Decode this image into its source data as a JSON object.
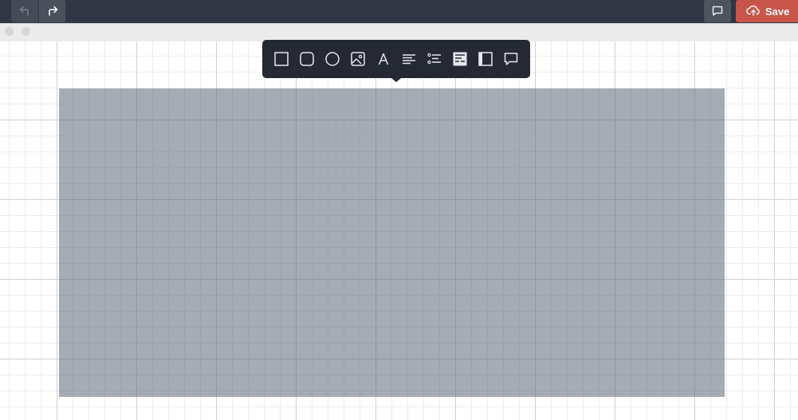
{
  "header": {
    "undo_icon": "undo-icon",
    "redo_icon": "redo-icon",
    "comment_icon": "speech-bubble-icon",
    "save_icon": "cloud-upload-icon",
    "save_label": "Save",
    "colors": {
      "topbar": "#303643",
      "save_button": "#c8554a"
    }
  },
  "window": {
    "controls": [
      "window-dot",
      "window-dot"
    ]
  },
  "toolbar": {
    "tools": [
      {
        "name": "rectangle-tool",
        "icon": "square-outline-icon"
      },
      {
        "name": "rounded-rectangle-tool",
        "icon": "rounded-square-icon"
      },
      {
        "name": "ellipse-tool",
        "icon": "circle-outline-icon"
      },
      {
        "name": "image-tool",
        "icon": "image-icon"
      },
      {
        "name": "text-tool",
        "icon": "letter-a-icon"
      },
      {
        "name": "paragraph-tool",
        "icon": "align-left-icon"
      },
      {
        "name": "list-tool",
        "icon": "bulleted-list-icon"
      },
      {
        "name": "form-tool",
        "icon": "form-block-icon"
      },
      {
        "name": "panel-tool",
        "icon": "sidebar-panel-icon"
      },
      {
        "name": "comment-tool",
        "icon": "speech-bubble-icon"
      }
    ],
    "colors": {
      "background": "#242934",
      "icon": "#e6e8ec"
    }
  },
  "canvas": {
    "grid": true,
    "selection_color": "#a2a9b1"
  }
}
